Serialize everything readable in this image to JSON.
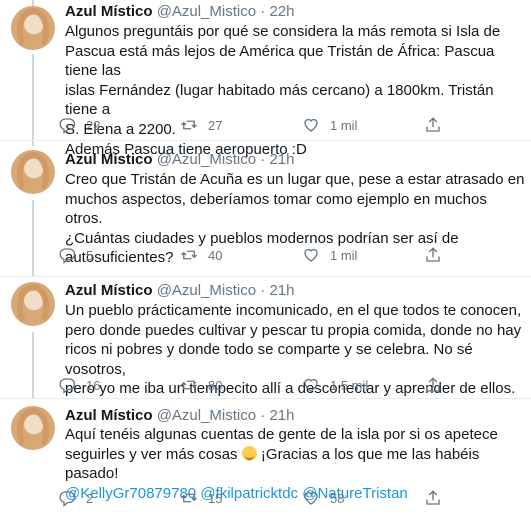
{
  "tweets": [
    {
      "name": "Azul Místico",
      "handle": "@Azul_Mistico",
      "dot": "·",
      "time": "22h",
      "lines": [
        "Algunos preguntáis por qué se considera la más remota si Isla de",
        "Pascua está más lejos de América que Tristán de África: Pascua tiene las",
        "islas Fernández (lugar habitado más cercano) a 1800km. Tristán tiene a",
        "S. Elena a 2200.",
        "Además Pascua tiene aeropuerto :D"
      ],
      "replies": "22",
      "retweets": "27",
      "likes": "1 mil"
    },
    {
      "name": "Azul Místico",
      "handle": "@Azul_Mistico",
      "dot": "·",
      "time": "21h",
      "lines": [
        "Creo que Tristán de Acuña es un lugar que, pese a estar atrasado en",
        "muchos aspectos, deberíamos tomar como ejemplo en muchos otros.",
        "¿Cuántas ciudades y pueblos modernos podrían ser así de",
        "autosuficientes?"
      ],
      "replies": "5",
      "retweets": "40",
      "likes": "1 mil"
    },
    {
      "name": "Azul Místico",
      "handle": "@Azul_Mistico",
      "dot": "·",
      "time": "21h",
      "lines": [
        "Un pueblo prácticamente incomunicado, en el que todos te conocen,",
        "pero donde puedes cultivar y pescar tu propia comida, donde no hay",
        "ricos ni pobres y donde todo se comparte y se celebra. No sé vosotros,",
        "pero yo me iba un tiempecito allí a desconectar y aprender de ellos."
      ],
      "replies": "16",
      "retweets": "80",
      "likes": "1,5 mil"
    },
    {
      "name": "Azul Místico",
      "handle": "@Azul_Mistico",
      "dot": "·",
      "time": "21h",
      "line1": "Aquí tenéis algunas cuentas de gente de la isla por si os apetece",
      "line2_before_emoji": "seguirles y ver más cosas",
      "line2_after_emoji": " ¡Gracias a los que me las habéis pasado!",
      "mentions": [
        "@KellyGr70879780",
        "@fkilpatricktdc",
        "@NatureTristan"
      ],
      "replies": "2",
      "retweets": "15",
      "likes": "58"
    }
  ],
  "icons": {
    "reply": "reply-icon",
    "retweet": "retweet-icon",
    "like": "heart-icon",
    "share": "share-icon"
  },
  "colors": {
    "text": "#14171a",
    "meta": "#657786",
    "link": "#1b95e0",
    "thread_line": "#ccd6dd",
    "divider": "#e6ecf0"
  }
}
